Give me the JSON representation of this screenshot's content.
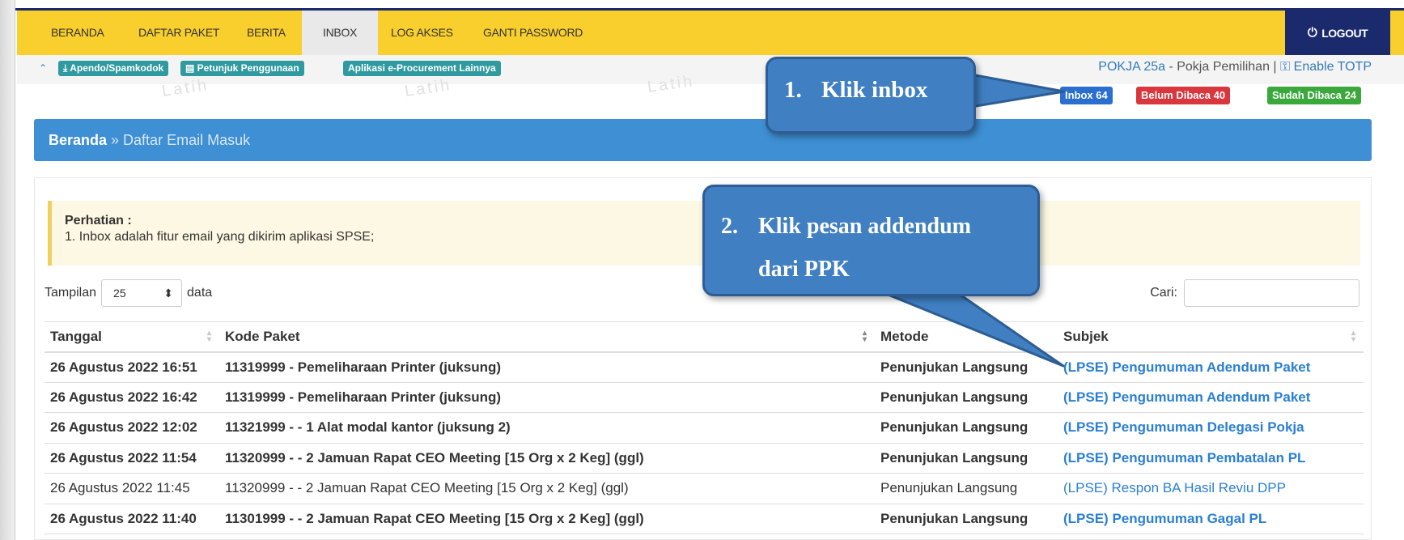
{
  "nav": {
    "items": [
      "BERANDA",
      "DAFTAR PAKET",
      "BERITA",
      "INBOX",
      "LOG AKSES",
      "GANTI PASSWORD"
    ],
    "active": "INBOX",
    "logout": "LOGOUT"
  },
  "toolbar": {
    "links": [
      "Apendo/Spamkodok",
      "Petunjuk Penggunaan",
      "Aplikasi e-Procurement Lainnya"
    ],
    "user_name": "POKJA 25a",
    "user_role": " - Pokja Pemilihan | ",
    "totp_link": "Enable TOTP",
    "badges": {
      "inbox": "Inbox 64",
      "unread": "Belum Dibaca 40",
      "read": "Sudah Dibaca 24"
    },
    "badge_colors": {
      "inbox": "#2a6fcf",
      "unread": "#d9363e",
      "read": "#3aa83a"
    }
  },
  "breadcrumb": {
    "home": "Beranda",
    "separator": " » ",
    "current": "Daftar Email Masuk"
  },
  "notice": {
    "title": "Perhatian :",
    "text": "1. Inbox adalah fitur email yang dikirim aplikasi SPSE;"
  },
  "table_controls": {
    "show_label": "Tampilan",
    "page_size": "25",
    "data_label": "data",
    "search_label": "Cari:"
  },
  "table": {
    "headers": [
      "Tanggal",
      "Kode Paket",
      "Metode",
      "Subjek"
    ],
    "rows": [
      {
        "date": "26 Agustus 2022 16:51",
        "code": "11319999 - Pemeliharaan Printer (juksung)",
        "method": "Penunjukan Langsung",
        "subject": "(LPSE) Pengumuman Adendum Paket",
        "unread": true
      },
      {
        "date": "26 Agustus 2022 16:42",
        "code": "11319999 - Pemeliharaan Printer (juksung)",
        "method": "Penunjukan Langsung",
        "subject": "(LPSE) Pengumuman Adendum Paket",
        "unread": true
      },
      {
        "date": "26 Agustus 2022 12:02",
        "code": "11321999 - - 1 Alat modal kantor (juksung 2)",
        "method": "Penunjukan Langsung",
        "subject": "(LPSE) Pengumuman Delegasi Pokja",
        "unread": true
      },
      {
        "date": "26 Agustus 2022 11:54",
        "code": "11320999 - - 2 Jamuan Rapat CEO Meeting [15 Org x 2 Keg] (ggl)",
        "method": "Penunjukan Langsung",
        "subject": "(LPSE) Pengumuman Pembatalan PL",
        "unread": true
      },
      {
        "date": "26 Agustus 2022 11:45",
        "code": "11320999 - - 2 Jamuan Rapat CEO Meeting [15 Org x 2 Keg] (ggl)",
        "method": "Penunjukan Langsung",
        "subject": "(LPSE) Respon BA Hasil Reviu DPP",
        "unread": false
      },
      {
        "date": "26 Agustus 2022 11:40",
        "code": "11301999 - - 2 Jamuan Rapat CEO Meeting [15 Org x 2 Keg] (ggl)",
        "method": "Penunjukan Langsung",
        "subject": "(LPSE) Pengumuman Gagal PL",
        "unread": true
      }
    ]
  },
  "callouts": {
    "step1_num": "1.",
    "step1_text": "Klik inbox",
    "step2_num": "2.",
    "step2_line1": "Klik pesan addendum",
    "step2_line2": "dari PPK"
  }
}
